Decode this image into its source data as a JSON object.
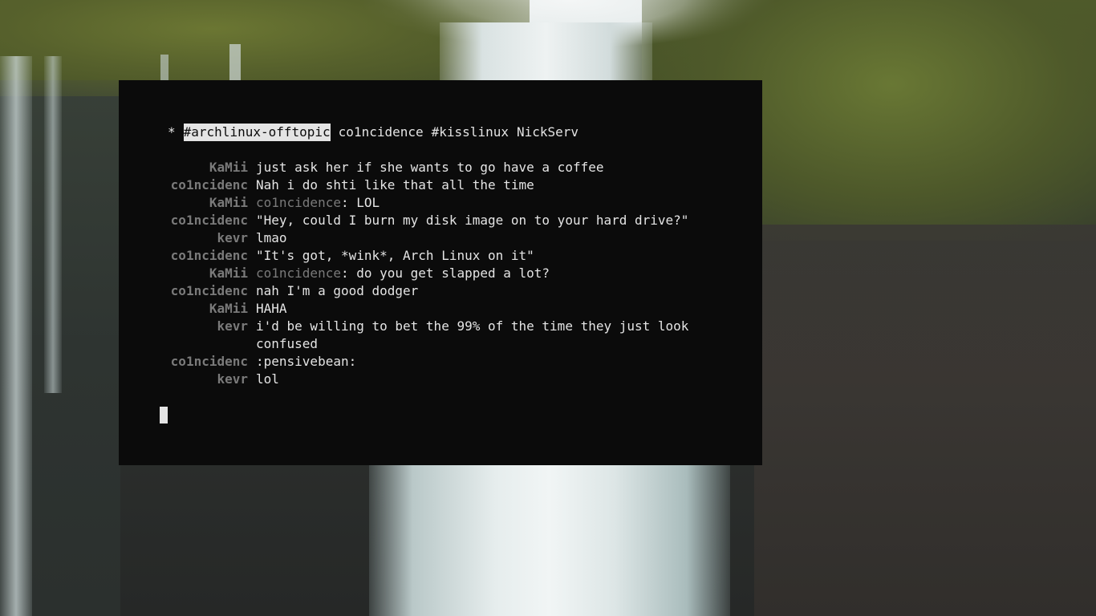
{
  "wallpaper": {
    "name": "waterfall-cliff-wallpaper"
  },
  "terminal": {
    "channel_bar": {
      "marker": "*",
      "items": [
        {
          "label": "#archlinux-offtopic",
          "active": true
        },
        {
          "label": "co1ncidence",
          "active": false
        },
        {
          "label": "#kisslinux",
          "active": false
        },
        {
          "label": "NickServ",
          "active": false
        }
      ]
    },
    "messages": [
      {
        "nick": "KaMii",
        "mention": "",
        "text": "just ask her if she wants to go have a coffee"
      },
      {
        "nick": "co1ncidenc",
        "mention": "",
        "text": "Nah i do shti like that all the time"
      },
      {
        "nick": "KaMii",
        "mention": "co1ncidence",
        "text": ": LOL"
      },
      {
        "nick": "co1ncidenc",
        "mention": "",
        "text": "\"Hey, could I burn my disk image on to your hard drive?\""
      },
      {
        "nick": "kevr",
        "mention": "",
        "text": "lmao"
      },
      {
        "nick": "co1ncidenc",
        "mention": "",
        "text": "\"It's got, *wink*, Arch Linux on it\""
      },
      {
        "nick": "KaMii",
        "mention": "co1ncidence",
        "text": ": do you get slapped a lot?"
      },
      {
        "nick": "co1ncidenc",
        "mention": "",
        "text": "nah I'm a good dodger"
      },
      {
        "nick": "KaMii",
        "mention": "",
        "text": "HAHA"
      },
      {
        "nick": "kevr",
        "mention": "",
        "text": "i'd be willing to bet the 99% of the time they just look confused"
      },
      {
        "nick": "co1ncidenc",
        "mention": "",
        "text": ":pensivebean:"
      },
      {
        "nick": "kevr",
        "mention": "",
        "text": "lol"
      }
    ],
    "input": {
      "value": ""
    }
  },
  "colors": {
    "terminal_bg": "#0b0b0b",
    "foreground": "#e4e4e4",
    "nick": "#7a7a7a"
  }
}
